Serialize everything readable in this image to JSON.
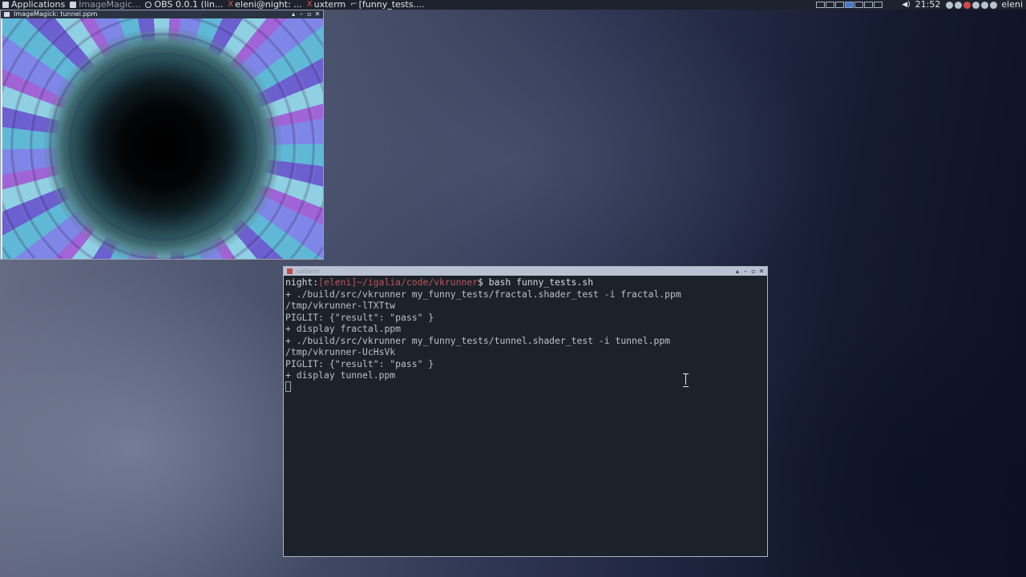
{
  "panel": {
    "menu_label": "Applications",
    "tasks": [
      {
        "label": "ImageMagic...",
        "icon": "imagemagick-icon",
        "active": true
      },
      {
        "label": "OBS 0.0.1 (lin...",
        "icon": "obs-icon",
        "active": false
      },
      {
        "label": "eleni@night: ...",
        "icon": "xterm-icon",
        "active": false
      },
      {
        "label": "uxterm",
        "icon": "xterm-icon",
        "active": false
      },
      {
        "label": "[funny_tests....",
        "icon": "terminal-icon",
        "active": false
      }
    ],
    "clock": "21:52",
    "user": "eleni"
  },
  "imagemagick_window": {
    "title": "ImageMagick: tunnel.ppm"
  },
  "terminal_window": {
    "title": "uxterm",
    "prompt": {
      "host": "night:",
      "user": "eleni",
      "path": "~/igalia/code/vkrunner",
      "symbol": "$",
      "command": " bash funny_tests.sh"
    },
    "output": [
      "+ ./build/src/vkrunner my_funny_tests/fractal.shader_test -i fractal.ppm",
      "/tmp/vkrunner-lTXTtw",
      "PIGLIT: {\"result\": \"pass\" }",
      "+ display fractal.ppm",
      "+ ./build/src/vkrunner my_funny_tests/tunnel.shader_test -i tunnel.ppm",
      "/tmp/vkrunner-UcHsVk",
      "PIGLIT: {\"result\": \"pass\" }",
      "+ display tunnel.ppm"
    ]
  },
  "colors": {
    "panel_bg": "#1d222c",
    "terminal_bg": "#1d222a",
    "prompt_accent": "#c0535a"
  }
}
